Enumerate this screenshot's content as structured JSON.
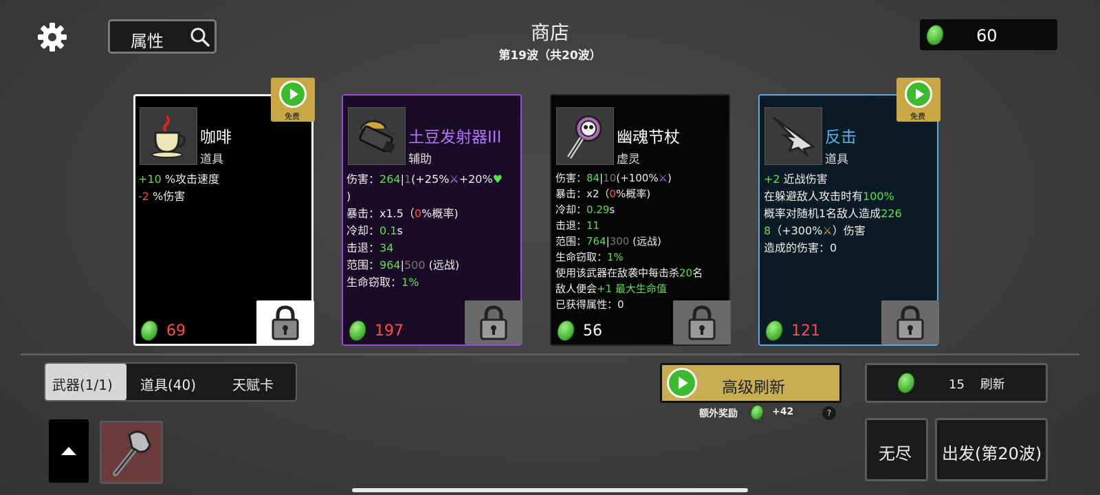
{
  "header": {
    "title": "商店",
    "wave": "第19波（共20波）",
    "stats_button": "属性",
    "currency": "60"
  },
  "cards": [
    {
      "name": "咖啡",
      "type": "道具",
      "price": "69",
      "free": "免费",
      "stats": [
        {
          "v": "+10",
          "t": " %攻击速度"
        },
        {
          "v": "-2",
          "t": " %伤害"
        }
      ]
    },
    {
      "name": "土豆发射器III",
      "type": "辅助",
      "price": "197",
      "dmg_a": "264",
      "dmg_b": "1",
      "dmg_c": "(+25%",
      "dmg_d": "+20%",
      "dmg_e": ")",
      "crit_a": "暴击：x1.5（",
      "crit_b": "0",
      "crit_c": "%概率)",
      "cd_label": "冷却：",
      "cd": "0.1",
      "cd_unit": "s",
      "kb_label": "击退：",
      "kb": "34",
      "range_label": "范围：",
      "range_a": "964",
      "range_b": "500",
      "range_c": " (远战)",
      "ls_label": "生命窃取：",
      "ls": "1%",
      "dmg_label": "伤害："
    },
    {
      "name": "幽魂节杖",
      "type": "虚灵",
      "price": "56",
      "dmg_label": "伤害：",
      "dmg_a": "84",
      "dmg_b": "10",
      "dmg_c": "(+100%",
      "dmg_d": ")",
      "crit_a": "暴击：x2（",
      "crit_b": "0",
      "crit_c": "%概率)",
      "cd_label": "冷却：",
      "cd": "0.29",
      "cd_unit": "s",
      "kb_label": "击退：",
      "kb": "11",
      "range_label": "范围：",
      "range_a": "764",
      "range_b": "300",
      "range_c": " (远战)",
      "ls_label": "生命窃取：",
      "ls": "1%",
      "kill_a": "使用该武器在敌袭中每击杀",
      "kill_b": "20",
      "kill_c": "名",
      "gain_a": "敌人便会",
      "gain_b": "+1 最大生命值",
      "got_label": "已获得属性：",
      "got": "0"
    },
    {
      "name": "反击",
      "type": "道具",
      "price": "121",
      "free": "免费",
      "l1_a": "+2",
      "l1_b": " 近战伤害",
      "l2_a": "在躲避敌人攻击时有",
      "l2_b": "100%",
      "l3_a": "概率对随机1名敌人造成",
      "l3_b": "226",
      "l4_a": "8",
      "l4_b": "（+300%",
      "l4_c": "）伤害",
      "l5": "造成的伤害：0"
    }
  ],
  "tabs": [
    "武器(1/1)",
    "道具(40)",
    "天赋卡"
  ],
  "buttons": {
    "advanced_refresh": "高级刷新",
    "bonus_label": "额外奖励",
    "bonus_value": "+42",
    "help": "?",
    "refresh_cost": "15",
    "refresh_label": "刷新",
    "endless": "无尽",
    "go": "出发(第20波)"
  },
  "colors": {
    "highlight_green": "#5fe04a",
    "price_red": "#ff4b4b",
    "rare_purple": "#b074ff",
    "card_blue": "#5aaae0",
    "gold": "#c9ad52"
  },
  "icons": [
    "gear-icon",
    "search-icon",
    "coin-icon",
    "coffee-icon",
    "potato-launcher-icon",
    "ghost-scepter-icon",
    "riposte-icon",
    "lock-icon",
    "play-icon",
    "heart-icon",
    "up-arrow-icon",
    "axe-icon"
  ]
}
